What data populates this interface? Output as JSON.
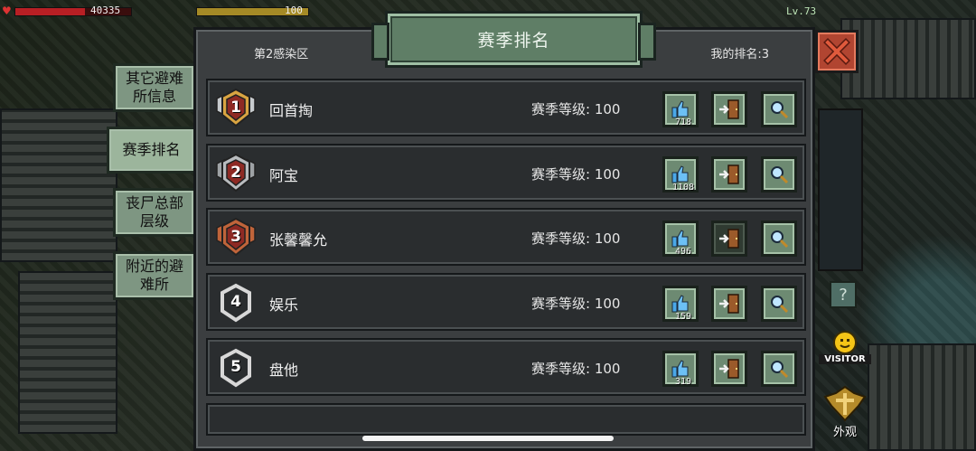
{
  "hud": {
    "hp_value": "40335",
    "hp_fraction": 0.6,
    "energy_value": "100",
    "energy_fraction": 1.0,
    "level": "Lv.73"
  },
  "side_tabs": [
    {
      "label": "其它避难所信息",
      "line1": "其它避难",
      "line2": "所信息",
      "active": false
    },
    {
      "label": "赛季排名",
      "line1": "赛季排名",
      "line2": "",
      "active": true
    },
    {
      "label": "丧尸总部层级",
      "line1": "丧尸总部",
      "line2": "层级",
      "active": false
    },
    {
      "label": "附近的避难所",
      "line1": "附近的避",
      "line2": "难所",
      "active": false
    }
  ],
  "panel": {
    "title": "赛季排名",
    "region": "第2感染区",
    "my_rank": "我的排名:3"
  },
  "ranking": [
    {
      "rank": "1",
      "name": "回首掏",
      "level_text": "赛季等级: 100",
      "likes": "718",
      "badge_style": "gold"
    },
    {
      "rank": "2",
      "name": "阿宝",
      "level_text": "赛季等级: 100",
      "likes": "1108",
      "badge_style": "silver"
    },
    {
      "rank": "3",
      "name": "张馨馨允",
      "level_text": "赛季等级: 100",
      "likes": "496",
      "badge_style": "bronze"
    },
    {
      "rank": "4",
      "name": "娱乐",
      "level_text": "赛季等级: 100",
      "likes": "159",
      "badge_style": "plain"
    },
    {
      "rank": "5",
      "name": "盘他",
      "level_text": "赛季等级: 100",
      "likes": "319",
      "badge_style": "plain"
    }
  ],
  "side_buttons": {
    "visitor_label": "VISITOR",
    "appearance_label": "外观",
    "help_glyph": "?"
  },
  "icons": {
    "like": "thumbs-up-icon",
    "visit": "enter-door-icon",
    "view": "magnifier-icon",
    "close": "close-icon"
  },
  "colors": {
    "accent_green": "#6d8a72",
    "close_red": "#b14531",
    "gold": "#d9a441",
    "silver": "#b9bcbf",
    "bronze": "#c0643a"
  }
}
